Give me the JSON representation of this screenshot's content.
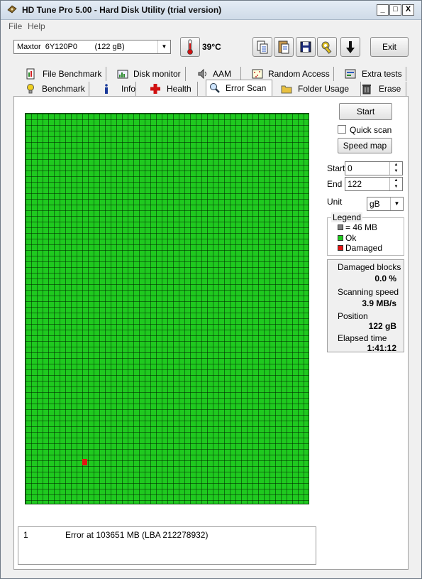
{
  "window": {
    "title": "HD Tune Pro 5.00 - Hard Disk Utility (trial version)",
    "minimize": "_",
    "maximize": "□",
    "close": "X"
  },
  "menu": {
    "file": "File",
    "help": "Help"
  },
  "toolbar": {
    "drive": "Maxtor  6Y120P0        (122 gB)",
    "temperature": "39°C",
    "exit_label": "Exit"
  },
  "tabs": {
    "row1": [
      {
        "label": "File Benchmark",
        "icon": "file-benchmark-icon"
      },
      {
        "label": "Disk monitor",
        "icon": "disk-monitor-icon"
      },
      {
        "label": "AAM",
        "icon": "speaker-icon"
      },
      {
        "label": "Random Access",
        "icon": "random-access-icon"
      },
      {
        "label": "Extra tests",
        "icon": "extra-tests-icon"
      }
    ],
    "row2": [
      {
        "label": "Benchmark",
        "icon": "lightbulb-icon"
      },
      {
        "label": "Info",
        "icon": "info-icon"
      },
      {
        "label": "Health",
        "icon": "health-cross-icon"
      },
      {
        "label": "Error Scan",
        "icon": "magnifier-icon"
      },
      {
        "label": "Folder Usage",
        "icon": "folder-icon"
      },
      {
        "label": "Erase",
        "icon": "trash-icon"
      }
    ]
  },
  "scan": {
    "start_button": "Start",
    "quick_scan_label": "Quick scan",
    "quick_scan_checked": false,
    "speed_map_button": "Speed map",
    "start_label": "Start",
    "start_value": "0",
    "end_label": "End",
    "end_value": "122",
    "unit_label": "Unit",
    "unit_value": "gB"
  },
  "legend": {
    "title": "Legend",
    "block_size": "= 46 MB",
    "ok": "Ok",
    "damaged": "Damaged",
    "colors": {
      "block": "#808080",
      "ok": "#1fc91f",
      "damaged": "#e51313"
    }
  },
  "stats": {
    "damaged_blocks_label": "Damaged blocks",
    "damaged_blocks_value": "0.0 %",
    "scanning_speed_label": "Scanning speed",
    "scanning_speed_value": "3.9 MB/s",
    "position_label": "Position",
    "position_value": "122 gB",
    "elapsed_label": "Elapsed time",
    "elapsed_value": "1:41:12"
  },
  "log": [
    {
      "index": "1",
      "message": "Error at 103651 MB (LBA 212278932)"
    }
  ]
}
